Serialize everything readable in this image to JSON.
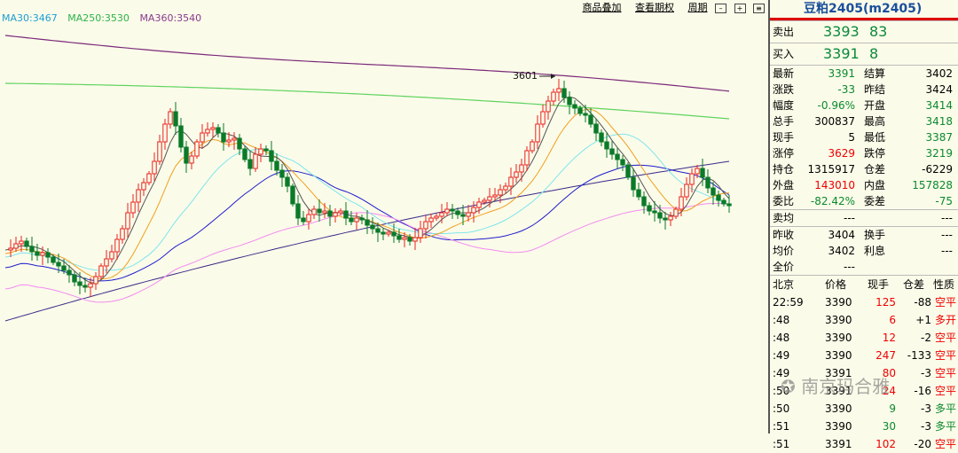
{
  "chart": {
    "ma_legend": [
      {
        "text": "MA30:3467",
        "color": "#1e9fd4"
      },
      {
        "text": "MA250:3530",
        "color": "#2ab34a"
      },
      {
        "text": "MA360:3540",
        "color": "#8a3a8f"
      }
    ],
    "toolbar": {
      "overlay": "商品叠加",
      "options": "查看期权",
      "period": "周期"
    },
    "annotation": "3601",
    "colors": {
      "up": "#e8231e",
      "down": "#0a7a28",
      "ma5": "#555555",
      "ma10": "#f0a020",
      "ma20": "#7ee6ec",
      "ma30": "#1e1ecc",
      "ma60": "#f28cf0",
      "ma120": "#3a2a8a",
      "ma250": "#5fd35f",
      "ma360": "#7a2a7a"
    }
  },
  "panel": {
    "title": "豆粕2405(m2405)",
    "ask": {
      "label": "卖出",
      "price": "3393",
      "qty": "83"
    },
    "bid": {
      "label": "买入",
      "price": "3391",
      "qty": "8"
    },
    "stats": [
      {
        "l1": "最新",
        "v1": "3391",
        "c1": "green",
        "l2": "结算",
        "v2": "3402",
        "c2": ""
      },
      {
        "l1": "涨跌",
        "v1": "-33",
        "c1": "green",
        "l2": "昨结",
        "v2": "3424",
        "c2": ""
      },
      {
        "l1": "幅度",
        "v1": "-0.96%",
        "c1": "green",
        "l2": "开盘",
        "v2": "3414",
        "c2": "green"
      },
      {
        "l1": "总手",
        "v1": "300837",
        "c1": "",
        "l2": "最高",
        "v2": "3418",
        "c2": "green"
      },
      {
        "l1": "现手",
        "v1": "5",
        "c1": "",
        "l2": "最低",
        "v2": "3387",
        "c2": "green"
      },
      {
        "l1": "涨停",
        "v1": "3629",
        "c1": "red",
        "l2": "跌停",
        "v2": "3219",
        "c2": "green"
      },
      {
        "l1": "持仓",
        "v1": "1315917",
        "c1": "",
        "l2": "仓差",
        "v2": "-6229",
        "c2": ""
      },
      {
        "l1": "外盘",
        "v1": "143010",
        "c1": "red",
        "l2": "内盘",
        "v2": "157828",
        "c2": "green"
      },
      {
        "l1": "委比",
        "v1": "-82.42%",
        "c1": "green",
        "l2": "委差",
        "v2": "-75",
        "c2": "green"
      }
    ],
    "avg": {
      "label": "卖均",
      "v1": "---",
      "v2": "---"
    },
    "stats2": [
      {
        "l1": "昨收",
        "v1": "3404",
        "c1": "",
        "l2": "换手",
        "v2": "---",
        "c2": ""
      },
      {
        "l1": "均价",
        "v1": "3402",
        "c1": "",
        "l2": "利息",
        "v2": "---",
        "c2": ""
      },
      {
        "l1": "全价",
        "v1": "---",
        "c1": "",
        "l2": "",
        "v2": "",
        "c2": ""
      }
    ],
    "ticks_header": [
      "北京",
      "价格",
      "现手",
      "仓差",
      "性质"
    ],
    "ticks": [
      {
        "t": "22:59",
        "p": "3390",
        "q": "125",
        "qc": "red",
        "d": "-88",
        "n": "空平",
        "nc": "red"
      },
      {
        "t": ":48",
        "p": "3390",
        "q": "6",
        "qc": "red",
        "d": "+1",
        "n": "多开",
        "nc": "red"
      },
      {
        "t": ":48",
        "p": "3390",
        "q": "12",
        "qc": "red",
        "d": "-2",
        "n": "空平",
        "nc": "red"
      },
      {
        "t": ":49",
        "p": "3390",
        "q": "247",
        "qc": "red",
        "d": "-133",
        "n": "空平",
        "nc": "red"
      },
      {
        "t": ":49",
        "p": "3391",
        "q": "80",
        "qc": "red",
        "d": "-3",
        "n": "空平",
        "nc": "red"
      },
      {
        "t": ":50",
        "p": "3391",
        "q": "24",
        "qc": "red",
        "d": "-16",
        "n": "空平",
        "nc": "red"
      },
      {
        "t": ":50",
        "p": "3390",
        "q": "9",
        "qc": "green",
        "d": "-3",
        "n": "多平",
        "nc": "green"
      },
      {
        "t": ":51",
        "p": "3390",
        "q": "30",
        "qc": "green",
        "d": "-3",
        "n": "多平",
        "nc": "green"
      },
      {
        "t": ":51",
        "p": "3391",
        "q": "102",
        "qc": "red",
        "d": "-20",
        "n": "空平",
        "nc": "red"
      }
    ],
    "watermark": "南京玛合雅"
  }
}
